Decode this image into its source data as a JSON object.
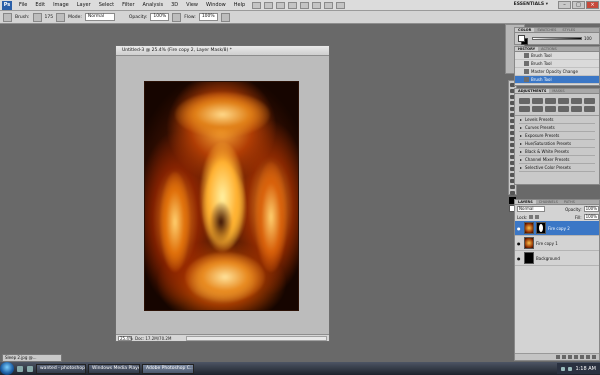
{
  "menubar": {
    "logo": "Ps",
    "items": [
      "File",
      "Edit",
      "Image",
      "Layer",
      "Select",
      "Filter",
      "Analysis",
      "3D",
      "View",
      "Window",
      "Help"
    ],
    "workspace": "ESSENTIALS ▾"
  },
  "options": {
    "brush_label": "Brush:",
    "brush_size": "175",
    "mode_label": "Mode:",
    "mode_value": "Normal",
    "opacity_label": "Opacity:",
    "opacity_value": "100%",
    "flow_label": "Flow:",
    "flow_value": "100%"
  },
  "document": {
    "title": "Untitled-3 @ 25.4% (Fire copy 2, Layer Mask/8) *",
    "zoom": "25.4%",
    "doc_info": "Doc: 17.2M/70.2M"
  },
  "panels": {
    "color_tabs": [
      "COLOR",
      "SWATCHES",
      "STYLES"
    ],
    "color_k_value": "100",
    "history_tabs": [
      "HISTORY",
      "ACTIONS"
    ],
    "history_items": [
      "Brush Tool",
      "Brush Tool",
      "Master Opacity Change",
      "Brush Tool"
    ],
    "adjust_tabs": [
      "ADJUSTMENTS",
      "MASKS"
    ],
    "presets": [
      "Levels Presets",
      "Curves Presets",
      "Exposure Presets",
      "Hue/Saturation Presets",
      "Black & White Presets",
      "Channel Mixer Presets",
      "Selective Color Presets"
    ],
    "layers_tabs": [
      "LAYERS",
      "CHANNELS",
      "PATHS"
    ],
    "blend_mode": "Normal",
    "opacity_label": "Opacity:",
    "opacity_value": "100%",
    "lock_label": "Lock:",
    "fill_label": "Fill:",
    "fill_value": "100%",
    "layers": [
      "Fire copy 2",
      "Fire copy 1",
      "Background"
    ]
  },
  "minimized_doc": "Sleep 2.jpg @...",
  "taskbar": {
    "tasks": [
      "wanted - photoshop ...",
      "Windows Media Player",
      "Adobe Photoshop C..."
    ],
    "clock": "1:18 AM"
  }
}
